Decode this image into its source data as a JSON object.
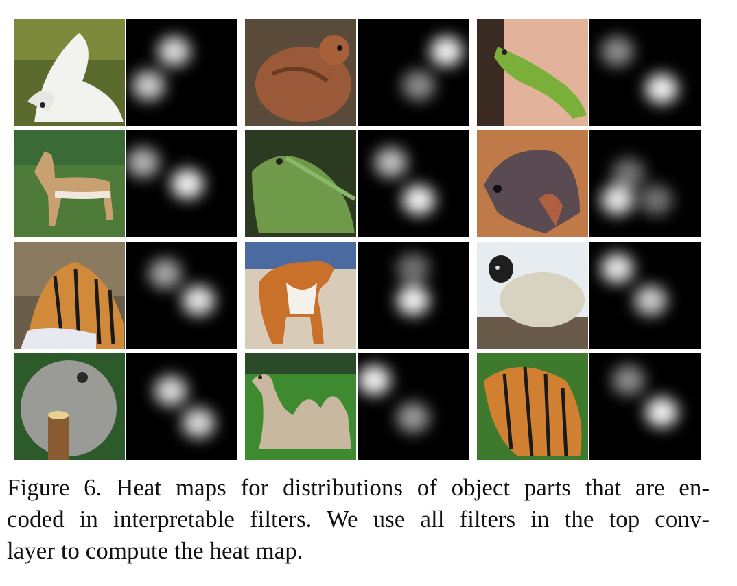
{
  "figure": {
    "caption_lines": [
      "Figure 6. Heat maps for distributions of object parts that are en-",
      "coded in interpretable filters.  We use all filters in the top conv-",
      "layer to compute the heat map."
    ]
  },
  "pairs": [
    {
      "subject": "white bird",
      "kind": "bird-white",
      "spots": [
        [
          0.43,
          0.3,
          0.85
        ],
        [
          0.2,
          0.62,
          0.8
        ]
      ]
    },
    {
      "subject": "brown partridge",
      "kind": "bird-brown",
      "spots": [
        [
          0.8,
          0.3,
          0.95
        ],
        [
          0.55,
          0.62,
          0.55
        ]
      ]
    },
    {
      "subject": "green lizard",
      "kind": "lizard",
      "spots": [
        [
          0.25,
          0.3,
          0.55
        ],
        [
          0.65,
          0.65,
          0.95
        ]
      ]
    },
    {
      "subject": "gazelle",
      "kind": "gazelle",
      "spots": [
        [
          0.15,
          0.3,
          0.7
        ],
        [
          0.55,
          0.5,
          0.95
        ]
      ]
    },
    {
      "subject": "green iguana",
      "kind": "iguana",
      "spots": [
        [
          0.3,
          0.3,
          0.75
        ],
        [
          0.55,
          0.65,
          0.95
        ]
      ]
    },
    {
      "subject": "brown lizard",
      "kind": "brownlizard",
      "spots": [
        [
          0.35,
          0.4,
          0.45
        ],
        [
          0.25,
          0.65,
          0.9
        ],
        [
          0.6,
          0.65,
          0.45
        ]
      ]
    },
    {
      "subject": "tiger lying",
      "kind": "tiger",
      "spots": [
        [
          0.35,
          0.3,
          0.65
        ],
        [
          0.65,
          0.55,
          0.9
        ]
      ]
    },
    {
      "subject": "boxer dog",
      "kind": "dog",
      "spots": [
        [
          0.5,
          0.25,
          0.45
        ],
        [
          0.5,
          0.55,
          0.95
        ]
      ]
    },
    {
      "subject": "sheep",
      "kind": "sheep",
      "spots": [
        [
          0.25,
          0.25,
          0.9
        ],
        [
          0.55,
          0.55,
          0.8
        ]
      ]
    },
    {
      "subject": "koala",
      "kind": "koala",
      "spots": [
        [
          0.4,
          0.35,
          0.85
        ],
        [
          0.65,
          0.65,
          0.85
        ]
      ]
    },
    {
      "subject": "camel",
      "kind": "camel",
      "spots": [
        [
          0.15,
          0.25,
          0.95
        ],
        [
          0.5,
          0.6,
          0.6
        ]
      ]
    },
    {
      "subject": "tiger drinking",
      "kind": "tiger2",
      "spots": [
        [
          0.35,
          0.25,
          0.55
        ],
        [
          0.65,
          0.55,
          0.95
        ]
      ]
    }
  ]
}
